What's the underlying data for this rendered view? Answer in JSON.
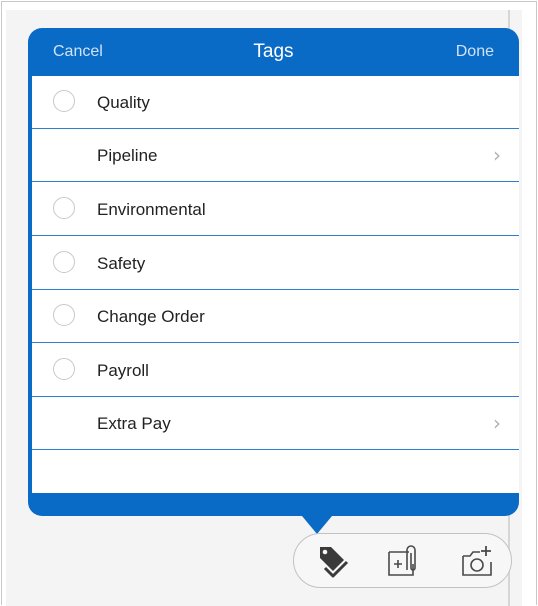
{
  "header": {
    "cancel_label": "Cancel",
    "title": "Tags",
    "done_label": "Done"
  },
  "rows": [
    {
      "label": "Quality",
      "selectable": true,
      "has_children": false
    },
    {
      "label": "Pipeline",
      "selectable": false,
      "has_children": true
    },
    {
      "label": "Environmental",
      "selectable": true,
      "has_children": false
    },
    {
      "label": "Safety",
      "selectable": true,
      "has_children": false
    },
    {
      "label": "Change Order",
      "selectable": true,
      "has_children": false
    },
    {
      "label": "Payroll",
      "selectable": true,
      "has_children": false
    },
    {
      "label": "Extra Pay",
      "selectable": false,
      "has_children": true
    }
  ],
  "toolbar": {
    "buttons": [
      "tag-icon",
      "attach-file-icon",
      "add-photo-icon"
    ]
  },
  "colors": {
    "accent": "#0a6bc6",
    "divider": "#2e7fcf"
  }
}
